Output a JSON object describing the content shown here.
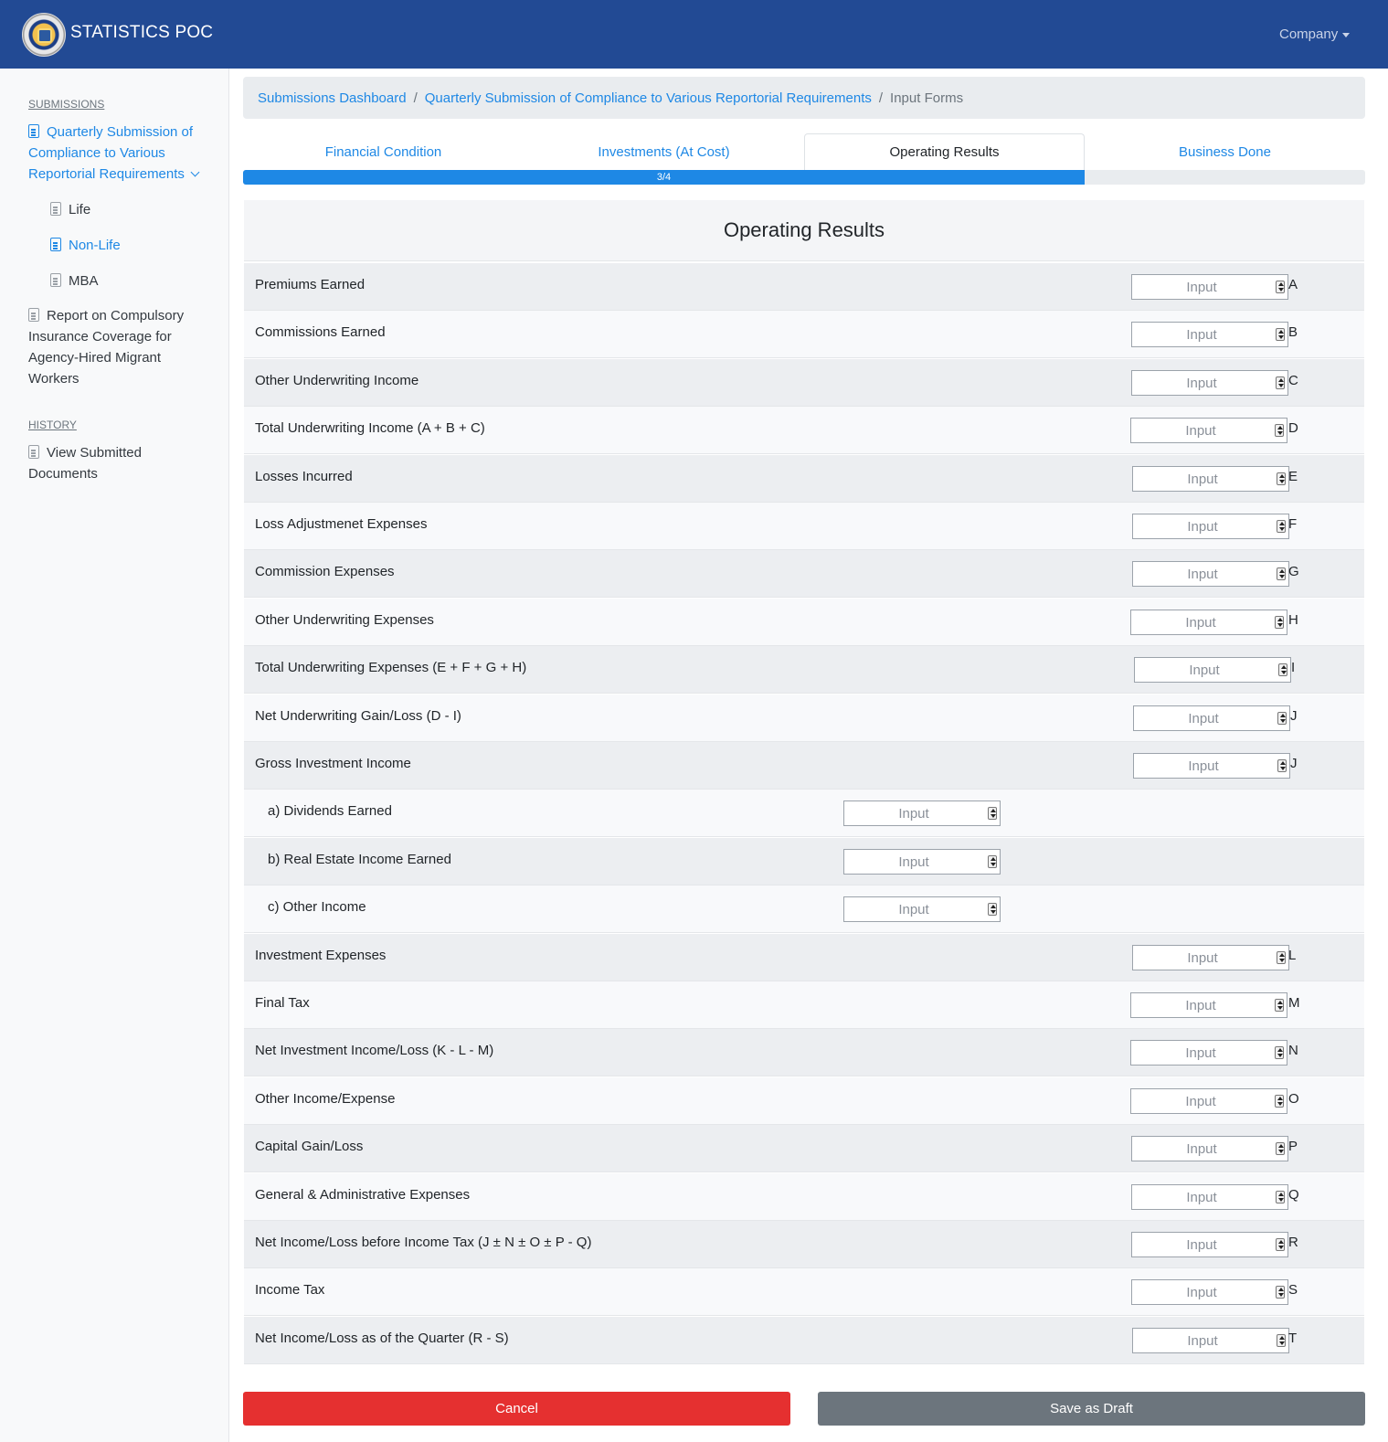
{
  "header": {
    "brand": "STATISTICS POC",
    "company_menu": "Company"
  },
  "sidebar": {
    "submissions_heading": "SUBMISSIONS",
    "quarterly_line1": "Quarterly Submission of",
    "quarterly_line2": "Compliance to Various",
    "quarterly_line3": "Reportorial Requirements",
    "sub_items": [
      "Life",
      "Non-Life",
      "MBA"
    ],
    "report_line1": "Report on Compulsory",
    "report_line2": "Insurance Coverage for",
    "report_line3": "Agency-Hired Migrant",
    "report_line4": "Workers",
    "history_heading": "HISTORY",
    "view_line1": "View Submitted",
    "view_line2": "Documents"
  },
  "breadcrumb": {
    "item1": "Submissions Dashboard",
    "item2": "Quarterly Submission of Compliance to Various Reportorial Requirements",
    "item3": "Input Forms",
    "separator": "/"
  },
  "tabs": [
    "Financial Condition",
    "Investments (At Cost)",
    "Operating Results",
    "Business Done"
  ],
  "active_tab": "Operating Results",
  "progress": {
    "label": "3/4",
    "fraction": 0.75
  },
  "form": {
    "title": "Operating Results",
    "placeholder": "Input",
    "rows": [
      {
        "label": "Premiums Earned",
        "letter": "A"
      },
      {
        "label": "Commissions Earned",
        "letter": "B"
      },
      {
        "label": "Other Underwriting Income",
        "letter": "C"
      },
      {
        "label": "Total Underwriting Income (A + B + C)",
        "letter": "D"
      },
      {
        "label": "Losses Incurred",
        "letter": "E"
      },
      {
        "label": "Loss Adjustmenet Expenses",
        "letter": "F"
      },
      {
        "label": "Commission Expenses",
        "letter": "G"
      },
      {
        "label": "Other Underwriting Expenses",
        "letter": "H"
      },
      {
        "label": "Total Underwriting Expenses (E + F + G + H)",
        "letter": "I"
      },
      {
        "label": "Net Underwriting Gain/Loss (D - I)",
        "letter": "J"
      },
      {
        "label": "Gross Investment Income",
        "letter": "J"
      },
      {
        "label": "a) Dividends Earned",
        "letter": ""
      },
      {
        "label": "b) Real Estate Income Earned",
        "letter": ""
      },
      {
        "label": "c) Other Income",
        "letter": ""
      },
      {
        "label": "Investment Expenses",
        "letter": "L"
      },
      {
        "label": "Final Tax",
        "letter": "M"
      },
      {
        "label": "Net Investment Income/Loss (K - L - M)",
        "letter": "N"
      },
      {
        "label": "Other Income/Expense",
        "letter": "O"
      },
      {
        "label": "Capital Gain/Loss",
        "letter": "P"
      },
      {
        "label": "General & Administrative Expenses",
        "letter": "Q"
      },
      {
        "label": "Net Income/Loss before Income Tax (J ± N ± O ± P - Q)",
        "letter": "R"
      },
      {
        "label": "Income Tax",
        "letter": "S"
      },
      {
        "label": "Net Income/Loss as of the Quarter (R - S)",
        "letter": "T"
      }
    ]
  },
  "buttons": {
    "cancel": "Cancel",
    "save_draft": "Save as Draft"
  },
  "colors": {
    "header_bg": "#224a94",
    "link_blue": "#1e88e5",
    "cancel_red": "#e53030",
    "draft_gray": "#6c757d"
  }
}
